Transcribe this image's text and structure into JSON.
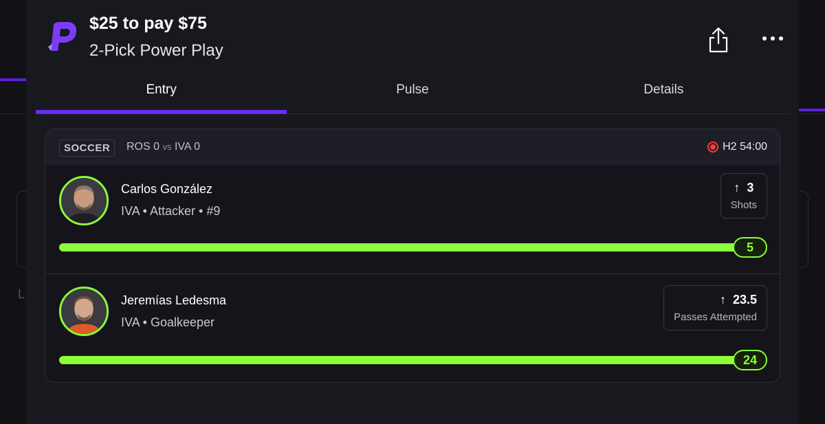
{
  "header": {
    "title": "$25 to pay $75",
    "subtitle": "2-Pick Power Play",
    "logo_icon": "prizepicks-logo-icon",
    "share_icon": "share-icon",
    "more_icon": "more-horizontal-icon"
  },
  "tabs": [
    {
      "label": "Entry",
      "active": true
    },
    {
      "label": "Pulse",
      "active": false
    },
    {
      "label": "Details",
      "active": false
    }
  ],
  "game": {
    "sport": "SOCCER",
    "team1": "ROS",
    "score1": "0",
    "vs": "vs",
    "team2": "IVA",
    "score2": "0",
    "clock": "H2 54:00",
    "live_icon": "live-record-icon"
  },
  "picks": [
    {
      "name": "Carlos González",
      "meta": "IVA • Attacker • #9",
      "direction_icon": "arrow-up-icon",
      "line": "3",
      "stat": "Shots",
      "current": "5",
      "progress": 1.0
    },
    {
      "name": "Jeremías Ledesma",
      "meta": "IVA • Goalkeeper",
      "direction_icon": "arrow-up-icon",
      "line": "23.5",
      "stat": "Passes Attempted",
      "current": "24",
      "progress": 1.0
    }
  ],
  "colors": {
    "accent": "#6c2bf2",
    "progress": "#8cff3a",
    "live": "#ff3b3b",
    "panel": "#18181f"
  }
}
